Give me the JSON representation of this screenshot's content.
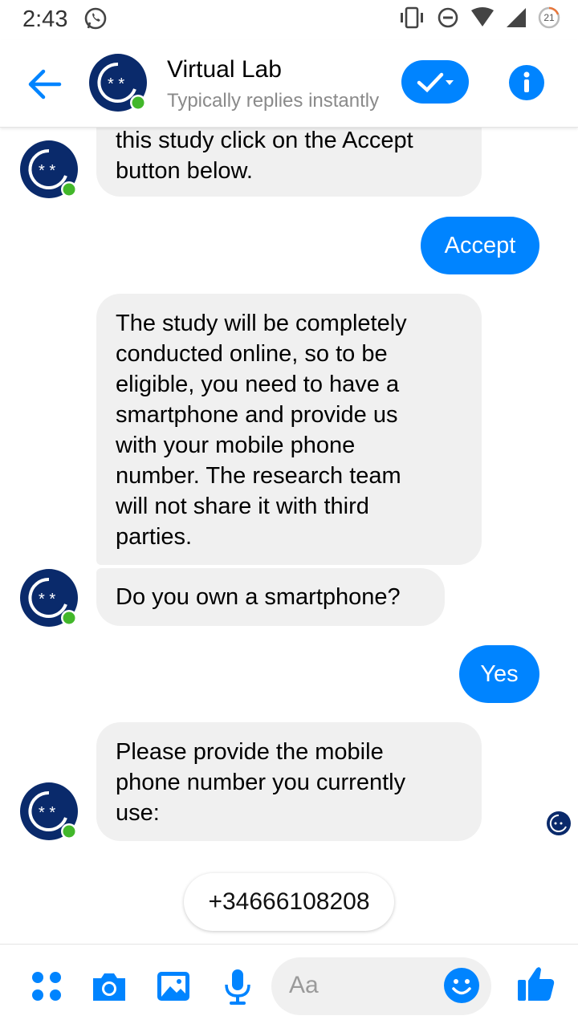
{
  "status_bar": {
    "time": "2:43",
    "battery_level": "21"
  },
  "header": {
    "title": "Virtual Lab",
    "subtitle": "Typically replies instantly",
    "accent_color": "#0084ff"
  },
  "messages": [
    {
      "from": "bot",
      "text_lines": [
        "this study click on the Accept",
        "button below."
      ]
    },
    {
      "from": "user",
      "text": "Accept"
    },
    {
      "from": "bot",
      "text_lines": [
        "The study will be completely",
        "conducted online, so to be",
        "eligible, you need to have a",
        "smartphone and provide us",
        "with your mobile phone",
        "number. The research team",
        "will not share it with third",
        "parties."
      ]
    },
    {
      "from": "bot",
      "text_lines": [
        "Do you own a smartphone?"
      ]
    },
    {
      "from": "user",
      "text": "Yes"
    },
    {
      "from": "bot",
      "text_lines": [
        "Please provide the mobile",
        "phone number you currently",
        "use:"
      ]
    }
  ],
  "quick_reply": {
    "label": "+34666108208"
  },
  "composer": {
    "placeholder": "Aa"
  }
}
